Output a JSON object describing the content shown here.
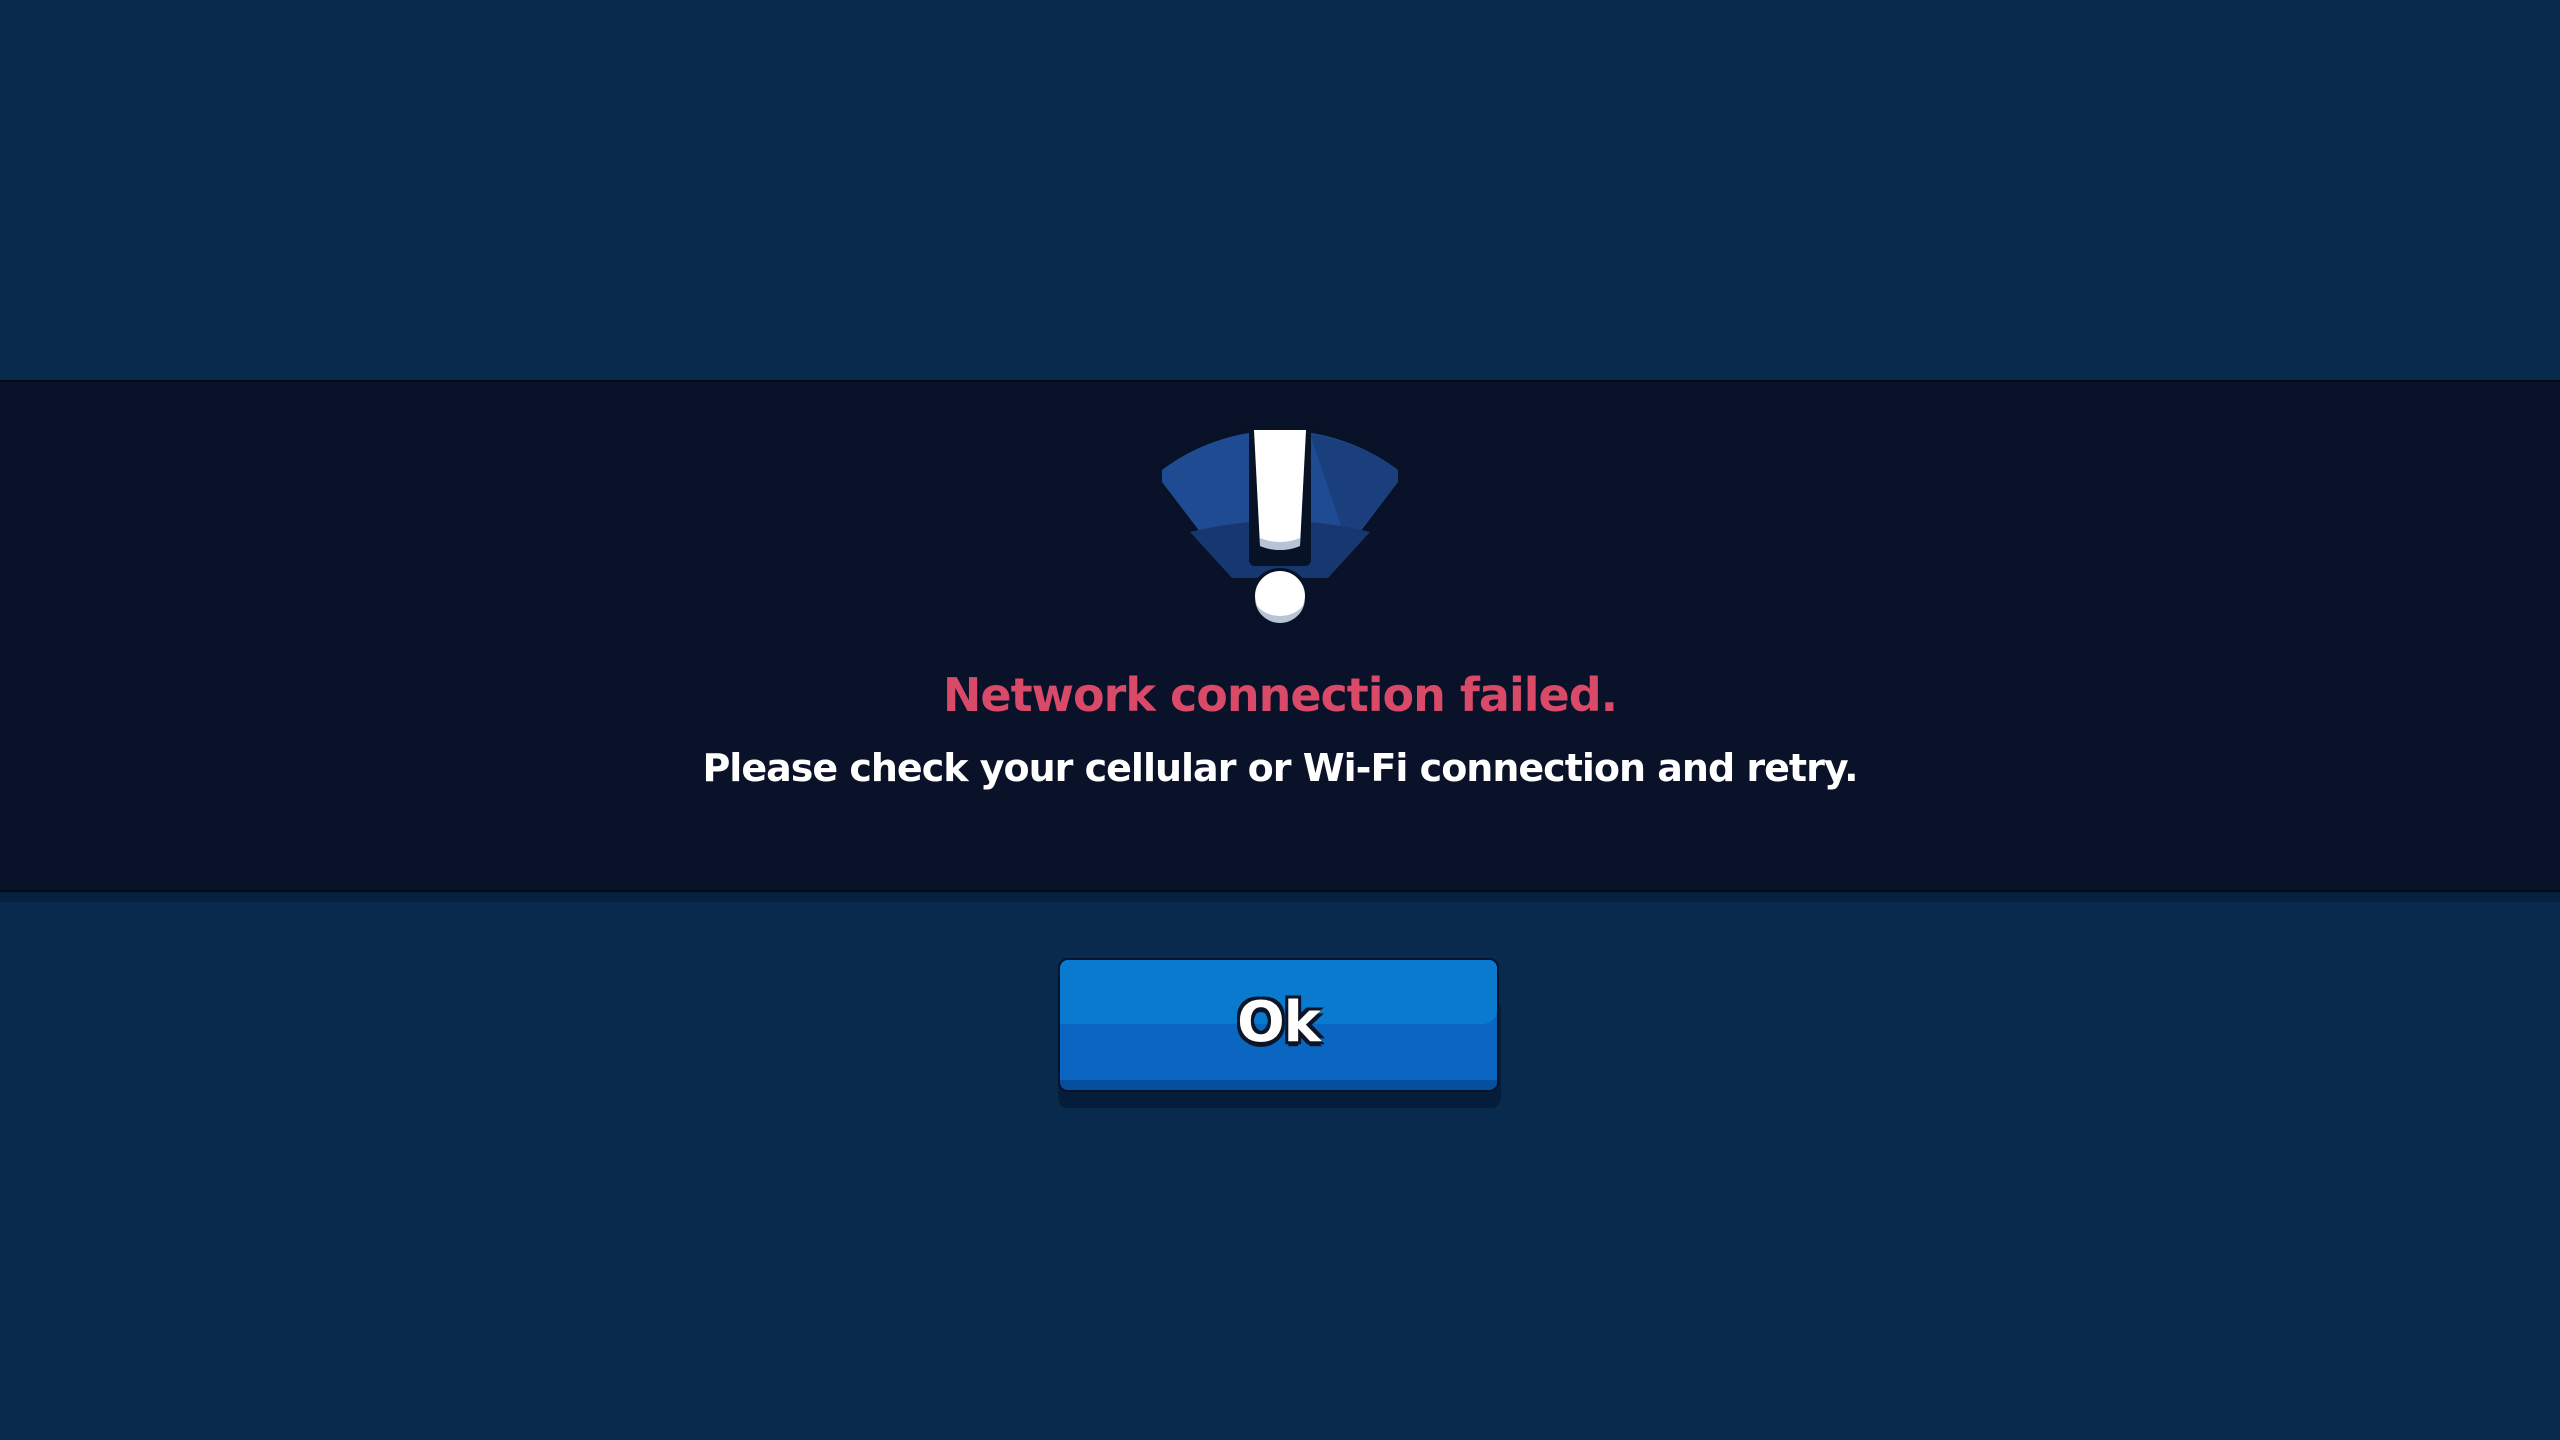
{
  "dialog": {
    "title": "Network connection failed.",
    "message": "Please check your cellular or Wi-Fi connection and retry.",
    "icon": "wifi-warning-icon",
    "ok_label": "Ok"
  },
  "colors": {
    "background": "#072a4d",
    "banner": "#0a1229",
    "title": "#d84a68",
    "message": "#ffffff",
    "button": "#0a7acf"
  }
}
